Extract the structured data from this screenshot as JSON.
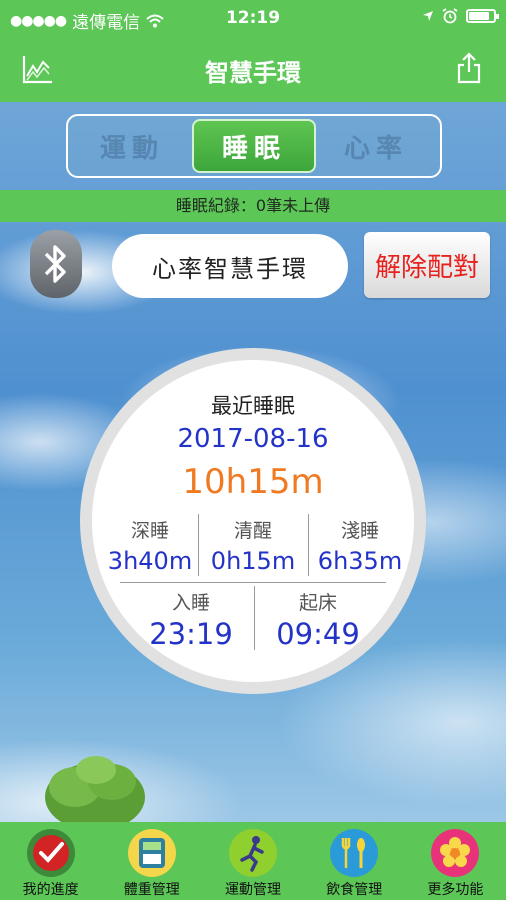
{
  "status_bar": {
    "carrier": "遠傳電信",
    "time": "12:19",
    "battery_level": 0.85
  },
  "nav": {
    "title": "智慧手環",
    "left_icon": "chart-icon",
    "right_icon": "share-icon"
  },
  "segments": [
    {
      "label": "運動",
      "active": false
    },
    {
      "label": "睡眠",
      "active": true
    },
    {
      "label": "心率",
      "active": false
    }
  ],
  "upload_status": "睡眠紀錄：0筆未上傳",
  "device": {
    "bluetooth_icon": "bluetooth-icon",
    "name": "心率智慧手環",
    "unpair_label": "解除配對"
  },
  "sleep": {
    "title": "最近睡眠",
    "date": "2017-08-16",
    "total": "10h15m",
    "stats": [
      {
        "label": "深睡",
        "value": "3h40m"
      },
      {
        "label": "清醒",
        "value": "0h15m"
      },
      {
        "label": "淺睡",
        "value": "6h35m"
      }
    ],
    "sleep_start_label": "入睡",
    "sleep_start": "23:19",
    "wake_label": "起床",
    "wake": "09:49"
  },
  "tabs": [
    {
      "label": "我的進度",
      "icon": "progress-icon"
    },
    {
      "label": "體重管理",
      "icon": "scale-icon"
    },
    {
      "label": "運動管理",
      "icon": "runner-icon"
    },
    {
      "label": "飲食管理",
      "icon": "utensils-icon"
    },
    {
      "label": "更多功能",
      "icon": "flower-icon"
    }
  ],
  "colors": {
    "green": "#5cc657",
    "date_blue": "#2433c7",
    "total_orange": "#f07a22",
    "unpair_red": "#e7211d"
  }
}
